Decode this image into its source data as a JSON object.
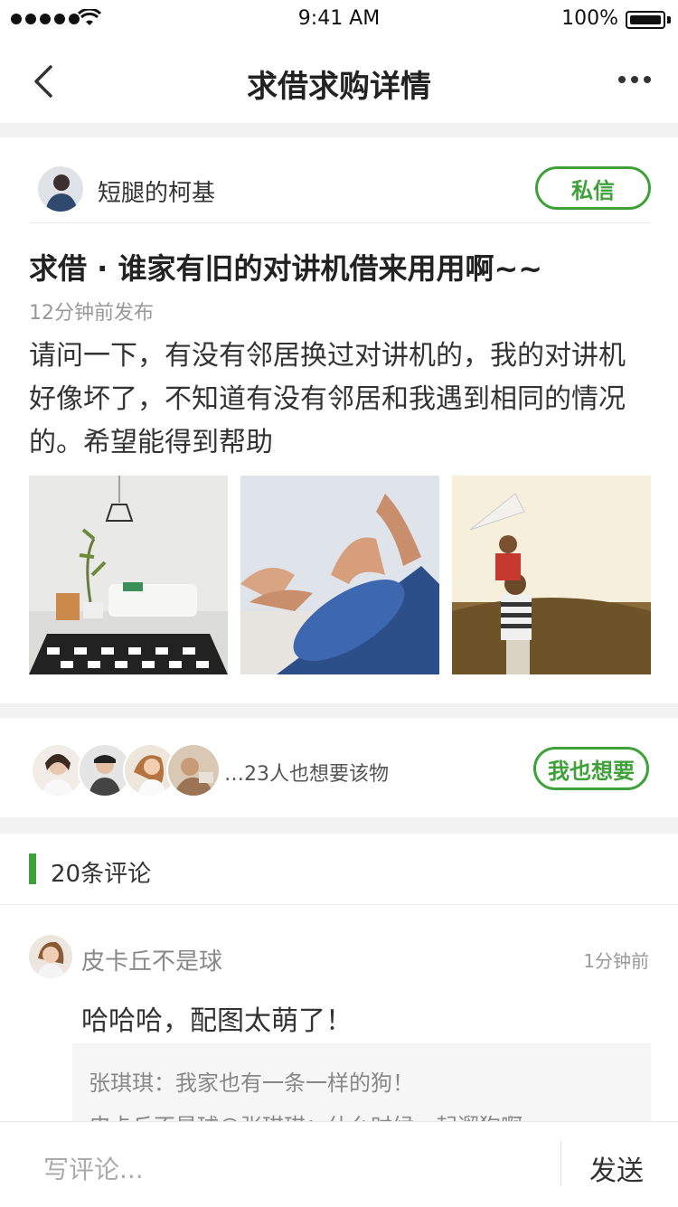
{
  "status_bar": {
    "time": "9:41 AM",
    "battery": "100%"
  },
  "nav": {
    "title": "求借求购详情"
  },
  "post": {
    "author": "短腿的柯基",
    "message_button": "私信",
    "title": "求借 · 谁家有旧的对讲机借来用用啊~~",
    "time": "12分钟前发布",
    "body": "请问一下，有没有邻居换过对讲机的，我的对讲机好像坏了，不知道有没有邻居和我遇到相同的情况的。希望能得到帮助",
    "photos": [
      "living-room photo",
      "yoga mat photo",
      "father and child kite photo"
    ]
  },
  "want": {
    "text": "…23人也想要该物",
    "button": "我也想要"
  },
  "comments": {
    "count_label": "20条评论",
    "items": [
      {
        "name": "皮卡丘不是球",
        "time": "1分钟前",
        "text": "哈哈哈，配图太萌了！",
        "replies": [
          "张琪琪：我家也有一条一样的狗！",
          "皮卡丘不是球@张琪琪：什么时候一起遛狗啊~"
        ]
      }
    ]
  },
  "bottom_bar": {
    "placeholder": "写评论...",
    "send": "发送"
  },
  "colors": {
    "accent": "#3fa13a"
  }
}
